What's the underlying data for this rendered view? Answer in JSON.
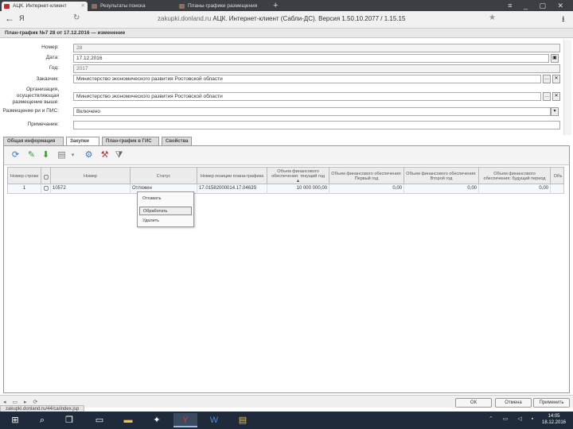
{
  "browser": {
    "tabs": [
      {
        "label": "АЦК. Интернет-клиент",
        "active": true
      },
      {
        "label": "Результаты поиска",
        "active": false
      },
      {
        "label": "Планы-графики размещения",
        "active": false
      }
    ],
    "new_tab": "+",
    "window_controls": "≡ _ ▢ ✕",
    "back": "←",
    "yandex": "Я",
    "url_host": "zakupki.donland.ru",
    "url_title": "АЦК. Интернет-клиент (Сабли-ДС). Версия 1.50.10.2077 / 1.15.15",
    "star": "★",
    "download": "⭳"
  },
  "window_title": "План-график №7 28 от 17.12.2016 — изменение",
  "form": {
    "number_label": "Номер:",
    "number_value": "28",
    "date_label": "Дата:",
    "date_value": "17.12.2016",
    "year_label": "Год:",
    "year_value": "2017",
    "customer_label": "Заказчик:",
    "customer_value": "Министерство экономического развития Ростовской области",
    "org_label": "Организация, осуществляющая размещение выше:",
    "org_value": "Министерство экономического развития Ростовской области",
    "placement_label": "Размещение ри и ПИС:",
    "placement_value": "Включено",
    "comment_label": "Примечание:",
    "comment_value": ""
  },
  "section_tabs": [
    "Общая информация",
    "Закупки",
    "План-график в ГИС",
    "Свойства"
  ],
  "grid": {
    "headers": [
      "Номер строки",
      "",
      "Номер",
      "Статус",
      "Номер позиции плана-графика",
      "Объем финансового обеспечения: текущий год ▲",
      "Объем финансового обеспечения: Первый год",
      "Объем финансового обеспечения: Второй год",
      "Объем финансового обеспечения: будущий период",
      "Объ"
    ],
    "rows": [
      {
        "line_no": "1",
        "number": "10572",
        "status": "Отложен",
        "position": "17.01582000014.17.0463S",
        "current": "10 000 000,00",
        "first": "0,00",
        "second": "0,00",
        "future": "0,00"
      }
    ]
  },
  "context_menu": [
    "Отозвать",
    "Обработать",
    "Удалить"
  ],
  "buttons": {
    "ok": "ОК",
    "cancel": "Отмена",
    "apply": "Применить"
  },
  "status_url": "zakupki.donland.ru/44/ca/index.jsp",
  "clock": {
    "time": "14:05",
    "date": "18.12.2016"
  }
}
